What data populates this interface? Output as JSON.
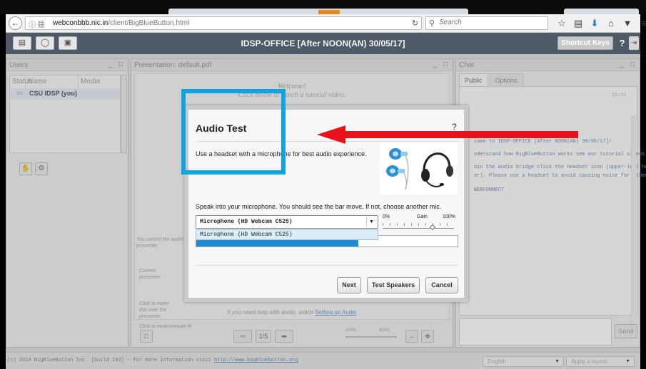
{
  "browser": {
    "url_host": "webconbbb.nic.in",
    "url_path": "/client/BigBlueButton.html",
    "search_placeholder": "Search"
  },
  "app": {
    "title": "IDSP-OFFICE [After NOON(AN) 30/05/17]",
    "shortcut_keys_label": "Shortcut Keys",
    "help_label": "?"
  },
  "users_panel": {
    "title": "Users",
    "col_status": "Status",
    "col_name": "Name",
    "col_media": "Media",
    "rows": [
      {
        "name": "CSU IDSP (you)"
      }
    ]
  },
  "presentation": {
    "title": "Presentation: default.pdf",
    "welcome_line1": "Welcome!",
    "welcome_line2": "Click below to watch a tutorial video.",
    "note_control": "You control the audio & presenter.",
    "note_current": "Current presenter",
    "note_click_make": "Click to make this user the presenter.",
    "note_mute": "Click to mute/unmute th",
    "audio_help_prefix": "If you need help with audio, watch",
    "audio_help_link": "Setting up Audio",
    "page_indicator": "1/5",
    "zoom_min": "100%",
    "zoom_max": "400%"
  },
  "chat": {
    "title": "Chat",
    "tabs": [
      "Public",
      "Options"
    ],
    "time": "15:31",
    "messages": [
      "come to IDSP-OFFICE [After NOON(AN) 30/05/17]!",
      "nderstand how BigBlueButton works see our tutorial videos.",
      "oin the audio bridge click the headset icon (upper-left hand",
      "er). Please use a headset to avoid causing noise for others.",
      "WEBCONNECT"
    ],
    "send_label": "Send"
  },
  "footer": {
    "copyright": "(c) 2014 BigBlueButton Inc. [build 193] - For more information visit",
    "link": "http://www.bigbluebutton.org",
    "language": "English",
    "layout": "Apply a layout"
  },
  "dialog": {
    "title": "Audio Test",
    "help": "?",
    "description": "Use a headset with a microphone for best audio experience.",
    "instruction": "Speak into your microphone. You should see the bar move. If not, choose another mic.",
    "selected_mic": "Microphone (HD Webcam C525)",
    "options": [
      "Microphone (HD Webcam C525)"
    ],
    "gain_min": "0%",
    "gain_label": "Gain",
    "gain_max": "100%",
    "gain_value": 0.7,
    "level_value": 0.62,
    "buttons": {
      "next": "Next",
      "test_speakers": "Test Speakers",
      "cancel": "Cancel"
    }
  },
  "colors": {
    "highlight_box": "#10a3df",
    "arrow": "#e8121a",
    "level_fill": "#1f8ad6",
    "header_bg": "#4e5a66"
  }
}
